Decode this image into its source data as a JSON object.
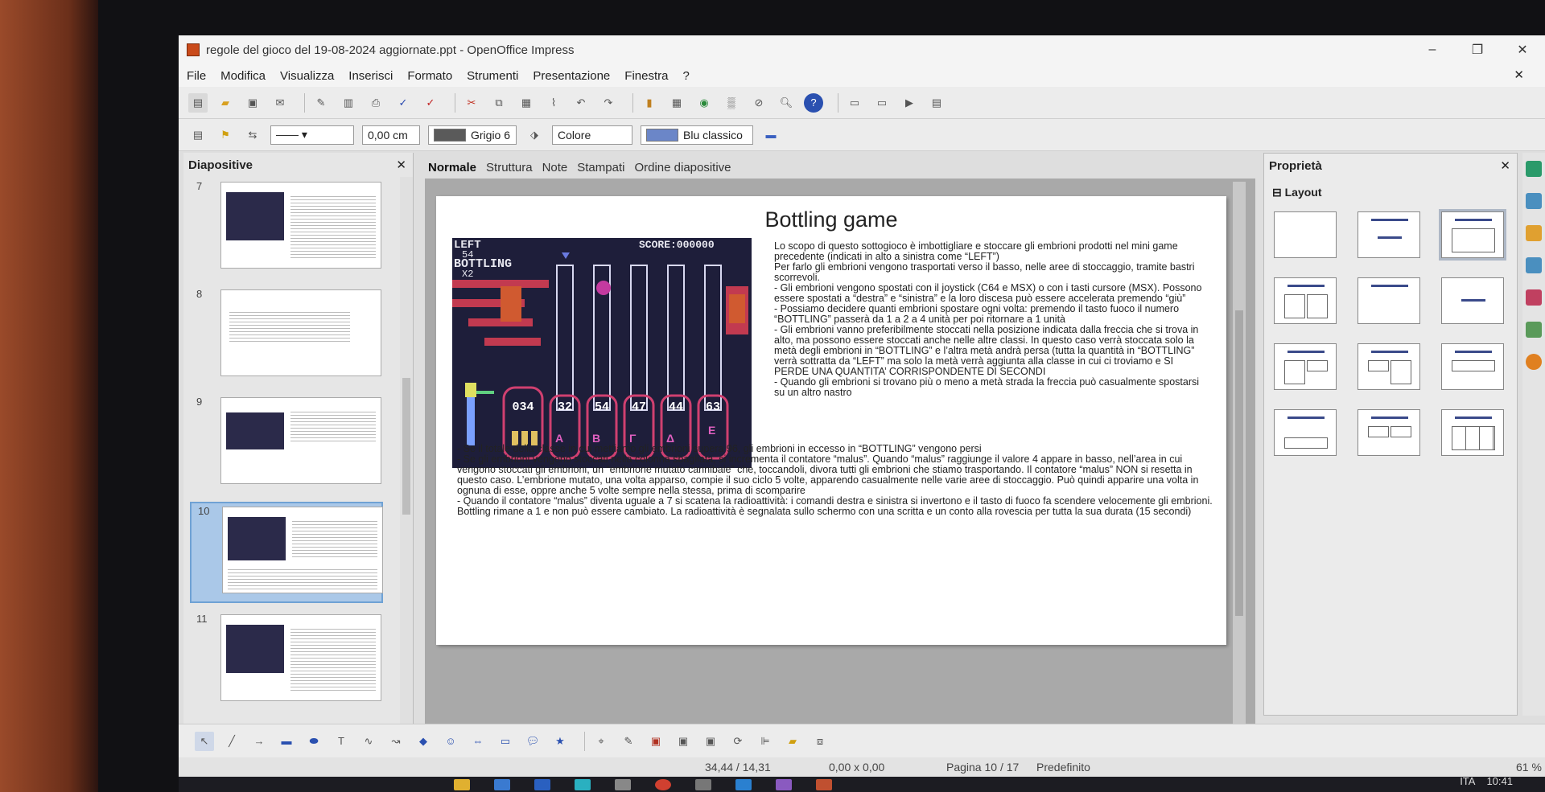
{
  "window": {
    "title": "regole del gioco del 19-08-2024 aggiornate.ppt - OpenOffice Impress",
    "controls": [
      "–",
      "❐",
      "✕"
    ]
  },
  "menu": [
    "File",
    "Modifica",
    "Visualizza",
    "Inserisci",
    "Formato",
    "Strumenti",
    "Presentazione",
    "Finestra",
    "?"
  ],
  "toolbar2": {
    "line_width": "0,00 cm",
    "line_color": "Grigio 6",
    "area_style": "Colore",
    "area_color": "Blu classico",
    "colors": {
      "line_swatch": "#5a5a5a",
      "area_swatch": "#6b86c8"
    }
  },
  "slides_panel": {
    "title": "Diapositive",
    "close": "✕",
    "slides": [
      {
        "number": "7",
        "selected": false
      },
      {
        "number": "8",
        "selected": false
      },
      {
        "number": "9",
        "selected": false
      },
      {
        "number": "10",
        "selected": true
      },
      {
        "number": "11",
        "selected": false
      }
    ]
  },
  "view_tabs": [
    "Normale",
    "Struttura",
    "Note",
    "Stampati",
    "Ordine diapositive"
  ],
  "slide": {
    "title": "Bottling game",
    "paragraphs_right": [
      "Lo scopo di questo sottogioco è imbottigliare e stoccare gli embrioni prodotti nel mini game precedente (indicati in alto a sinistra come “LEFT”)",
      "Per farlo gli embrioni vengono trasportati verso il basso, nelle aree di stoccaggio, tramite bastri scorrevoli.",
      "- Gli embrioni vengono spostati con il joystick (C64 e MSX) o con i tasti cursore (MSX). Possono essere spostati a “destra” e “sinistra” e la loro discesa può essere accelerata premendo “giù”",
      "- Possiamo decidere quanti embrioni spostare ogni volta: premendo il tasto fuoco il numero “BOTTLING” passerà da 1 a 2 a 4 unità per poi ritornare a 1 unità",
      "- Gli embrioni vanno preferibilmente stoccati nella posizione indicata dalla freccia che si trova in alto, ma possono essere stoccati anche nelle altre classi. In questo caso verrà stoccata solo la metà degli embrioni in “BOTTLING” e l’altra metà andrà persa (tutta la quantità in “BOTTLING” verrà sottratta da “LEFT” ma solo la metà verrà aggiunta alla classe in cui ci troviamo e SI PERDE UNA QUANTITA’ CORRISPONDENTE DI SECONDI",
      "- Quando gli embrioni si trovano più o meno a metà strada la freccia può casualmente spostarsi su un altro nastro"
    ],
    "paragraphs_bottom": [
      "- Se il totale della classe in cui mettiamo gli embrioni supera 96, gli embrioni in eccesso in “BOTTLING” vengono persi",
      "- Se gli embrioni vengono stoccati nella colonna sbagliata, si incrementa il contatore “malus”. Quando “malus” raggiunge il valore 4 appare in basso, nell’area in cui vengono stoccati gli embrioni, un “embrione mutato cannibale” che, toccandoli, divora tutti gli embrioni che stiamo trasportando. Il contatore “malus” NON si resetta in questo caso. L’embrione mutato, una volta apparso, compie il suo ciclo 5 volte, apparendo casualmente nelle varie aree di stoccaggio. Può quindi apparire una volta in ognuna di esse, oppre anche 5 volte sempre nella stessa, prima di scomparire",
      "- Quando il contatore “malus” diventa uguale a 7 si scatena la radioattività: i comandi destra e sinistra si invertono e il tasto di fuoco fa scendere velocemente gli embrioni. Bottling rimane a 1 e non può essere cambiato. La radioattività è segnalata sullo schermo con una scritta e un conto alla rovescia per tutta la sua durata (15 secondi)"
    ],
    "game": {
      "left_label": "LEFT",
      "left_value": "54",
      "bottling_label": "BOTTLING",
      "bottling_value": "X2",
      "score_label": "SCORE:000000",
      "counts": [
        "034",
        "32",
        "54",
        "47",
        "44",
        "63"
      ],
      "class_letters": [
        "",
        "A",
        "B",
        "Γ",
        "Δ",
        "E"
      ]
    }
  },
  "properties": {
    "title": "Proprietà",
    "close": "✕",
    "section": "⊟ Layout"
  },
  "status": {
    "position": "34,44 / 14,31",
    "size": "0,00 x 0,00",
    "page": "Pagina 10 / 17",
    "master": "Predefinito",
    "zoom": "61 %"
  },
  "taskbar": {
    "language": "ITA",
    "time": "10:41"
  }
}
